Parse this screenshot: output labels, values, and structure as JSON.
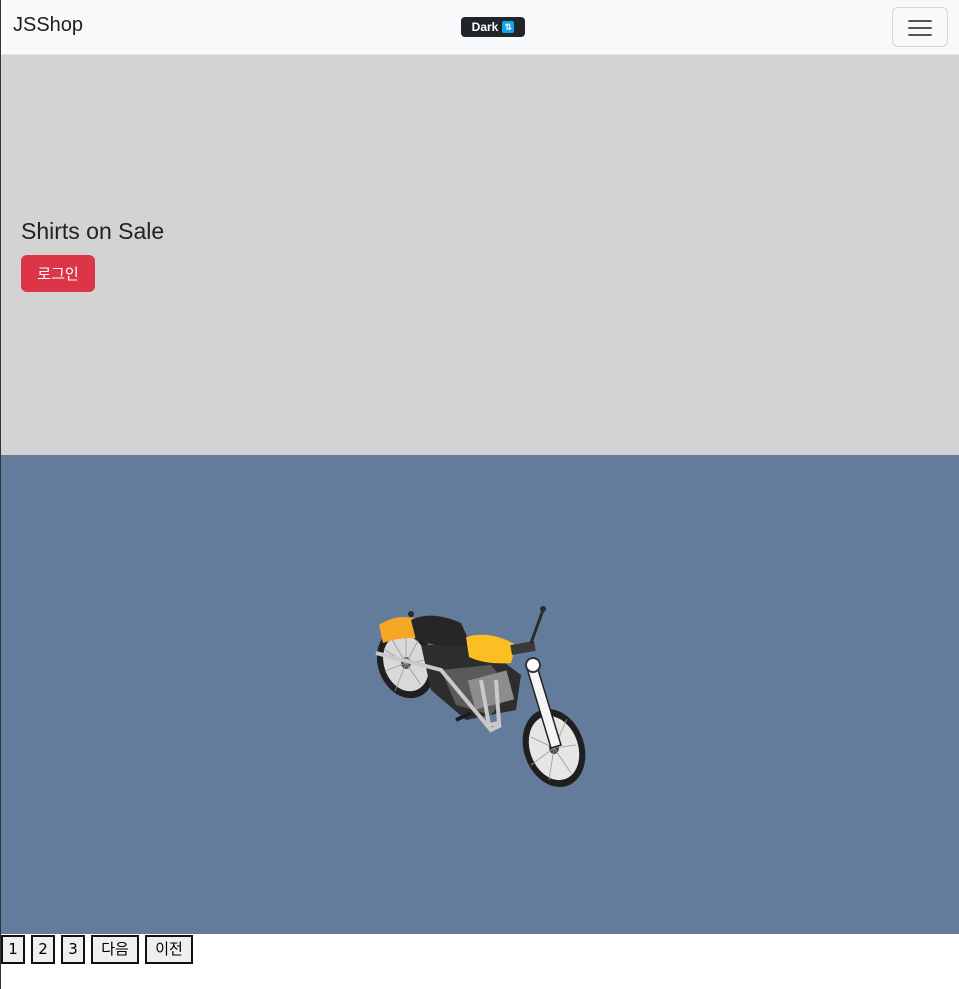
{
  "navbar": {
    "brand": "JSShop",
    "theme_toggle_label": "Dark",
    "theme_toggle_icon": "toggle-icon",
    "menu_icon": "hamburger-icon"
  },
  "hero": {
    "title": "Shirts on Sale",
    "login_label": "로그인",
    "login_color": "#dc3545",
    "background": "#d3d3d3"
  },
  "product": {
    "background": "#637c9b",
    "image": "motorcycle-illustration"
  },
  "pagination": {
    "pages": [
      "1",
      "2",
      "3"
    ],
    "next_label": "다음",
    "prev_label": "이전"
  }
}
